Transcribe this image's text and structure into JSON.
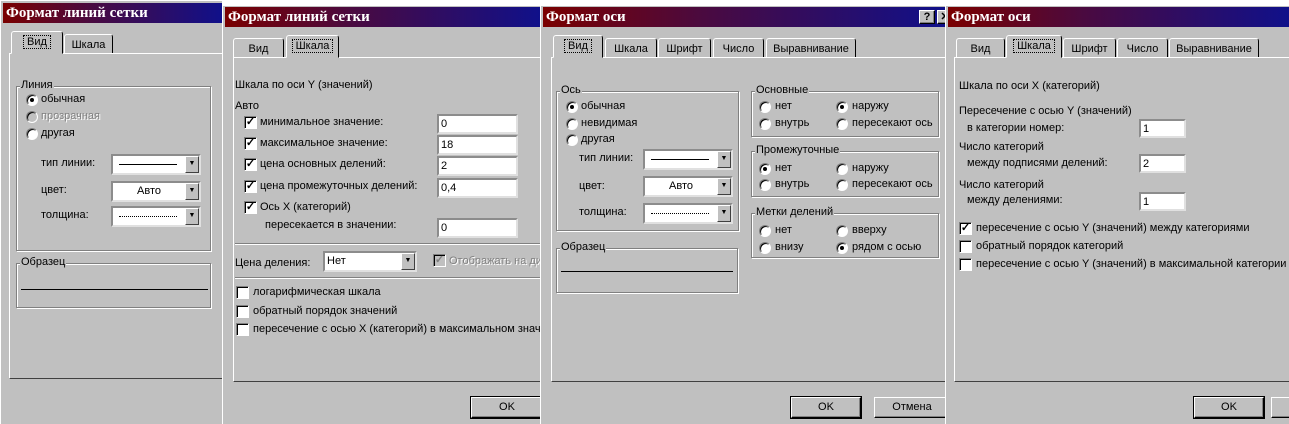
{
  "d1": {
    "title": "Формат линий сетки",
    "tabs": [
      "Вид",
      "Шкала"
    ],
    "line_legend": "Линия",
    "line_options": [
      "обычная",
      "прозрачная",
      "другая"
    ],
    "type_label": "тип линии:",
    "color_label": "цвет:",
    "color_value": "Авто",
    "weight_label": "толщина:",
    "sample_legend": "Образец"
  },
  "d2": {
    "title": "Формат линий сетки",
    "tabs": [
      "Вид",
      "Шкала"
    ],
    "scale_title": "Шкала по оси Y (значений)",
    "auto_label": "Авто",
    "rows": [
      {
        "label": "минимальное значение:",
        "value": "0"
      },
      {
        "label": "максимальное значение:",
        "value": "18"
      },
      {
        "label": "цена основных делений:",
        "value": "2"
      },
      {
        "label": "цена промежуточных делений:",
        "value": "0,4"
      },
      {
        "label": "Ось X (категорий)"
      }
    ],
    "cross_label": "пересекается в значении:",
    "cross_value": "0",
    "tick_label": "Цена деления:",
    "tick_value": "Нет",
    "display_label": "Отображать на ди",
    "options": [
      "логарифмическая шкала",
      "обратный порядок значений",
      "пересечение с осью X (категорий) в максимальном значе"
    ],
    "ok": "OK",
    "check": "✓"
  },
  "d3": {
    "title": "Формат оси",
    "help": "?",
    "tabs": [
      "Вид",
      "Шкала",
      "Шрифт",
      "Число",
      "Выравнивание"
    ],
    "axis_legend": "Ось",
    "axis_options": [
      "обычная",
      "невидимая",
      "другая"
    ],
    "type_label": "тип линии:",
    "color_label": "цвет:",
    "color_value": "Авто",
    "weight_label": "толщина:",
    "sample_legend": "Образец",
    "major": {
      "legend": "Основные",
      "options": [
        "нет",
        "наружу",
        "внутрь",
        "пересекают ось"
      ]
    },
    "minor": {
      "legend": "Промежуточные",
      "options": [
        "нет",
        "наружу",
        "внутрь",
        "пересекают ось"
      ]
    },
    "labels": {
      "legend": "Метки делений",
      "options": [
        "нет",
        "вверху",
        "внизу",
        "рядом с осью"
      ]
    },
    "ok": "OK",
    "cancel": "Отмена"
  },
  "d4": {
    "title": "Формат оси",
    "tabs": [
      "Вид",
      "Шкала",
      "Шрифт",
      "Число",
      "Выравнивание"
    ],
    "scale_title": "Шкала по оси X (категорий)",
    "fields": [
      {
        "l1": "Пересечение с осью Y (значений)",
        "l2": "в категории номер:",
        "value": "1"
      },
      {
        "l1": "Число категорий",
        "l2": "между подписями делений:",
        "value": "2"
      },
      {
        "l1": "Число категорий",
        "l2": "между делениями:",
        "value": "1"
      }
    ],
    "checks": [
      "пересечение с осью Y (значений) между категориями",
      "обратный порядок категорий",
      "пересечение с осью Y (значений) в максимальной категории"
    ],
    "ok": "OK",
    "check": "✓"
  }
}
